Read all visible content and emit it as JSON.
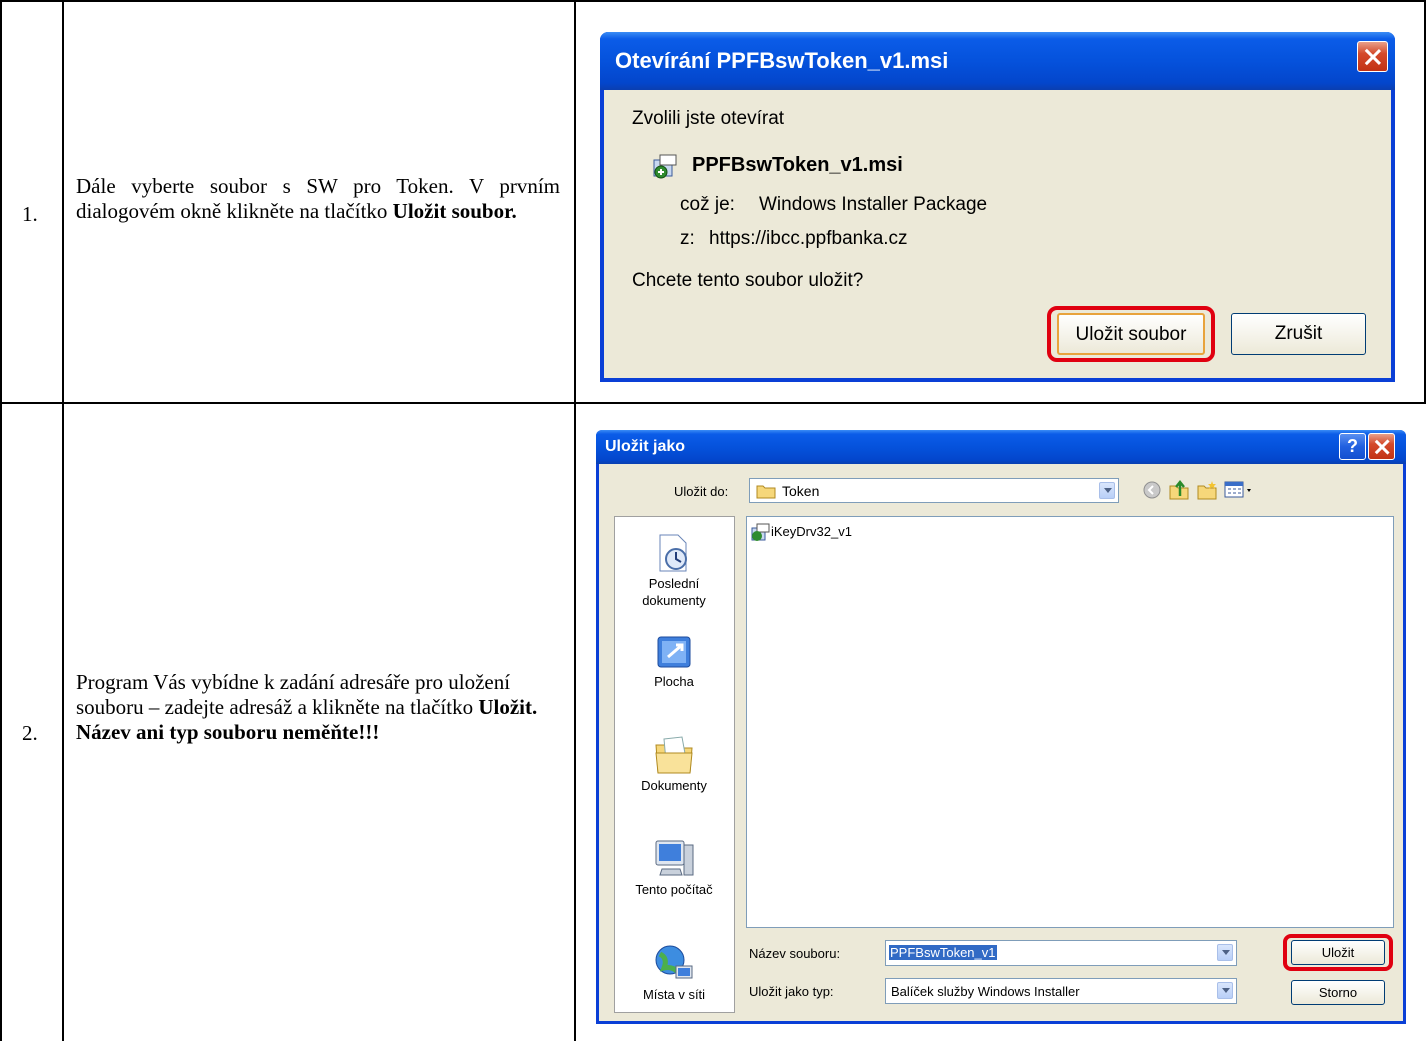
{
  "steps": [
    {
      "number": "1.",
      "text_plain": "Dále vyberte soubor s SW pro Token. V prvním dialogovém okně klikněte na tlačítko ",
      "text_bold": "Uložit soubor."
    },
    {
      "number": "2.",
      "text_plain": "Program Vás vybídne k zadání adresáře pro uložení souboru – zadejte adresáž a klikněte na tlačítko ",
      "text_bold": "Uložit.",
      "text_bold2": "Název ani typ souboru neměňte!!!"
    }
  ],
  "open_dialog": {
    "title": "Otevírání PPFBswToken_v1.msi",
    "intro": "Zvolili jste otevírat",
    "file_name": "PPFBswToken_v1.msi",
    "type_label": "což je:",
    "type_value": "Windows Installer Package",
    "from_label": "z:",
    "from_value": "https://ibcc.ppfbanka.cz",
    "question": "Chcete tento soubor uložit?",
    "save_button": "Uložit soubor",
    "cancel_button": "Zrušit"
  },
  "save_dialog": {
    "title": "Uložit jako",
    "help_label": "?",
    "save_in_label": "Uložit do:",
    "save_in_value": "Token",
    "places": [
      {
        "label": "Poslední dokumenty",
        "icon": "recent-documents-icon"
      },
      {
        "label": "Plocha",
        "icon": "desktop-icon"
      },
      {
        "label": "Dokumenty",
        "icon": "documents-folder-icon"
      },
      {
        "label": "Tento počítač",
        "icon": "my-computer-icon"
      },
      {
        "label": "Místa v síti",
        "icon": "network-places-icon"
      }
    ],
    "files": [
      {
        "name": "iKeyDrv32_v1",
        "icon": "msi-package-icon"
      }
    ],
    "filename_label": "Název souboru:",
    "filename_value": "PPFBswToken_v1",
    "filetype_label": "Uložit jako typ:",
    "filetype_value": "Balíček služby Windows Installer",
    "save_button": "Uložit",
    "cancel_button": "Storno"
  },
  "colors": {
    "xp_title_blue": "#0552dc",
    "xp_dialog_bg": "#ece9d8",
    "highlight_red": "#e00010",
    "selection_blue": "#316ac5"
  }
}
